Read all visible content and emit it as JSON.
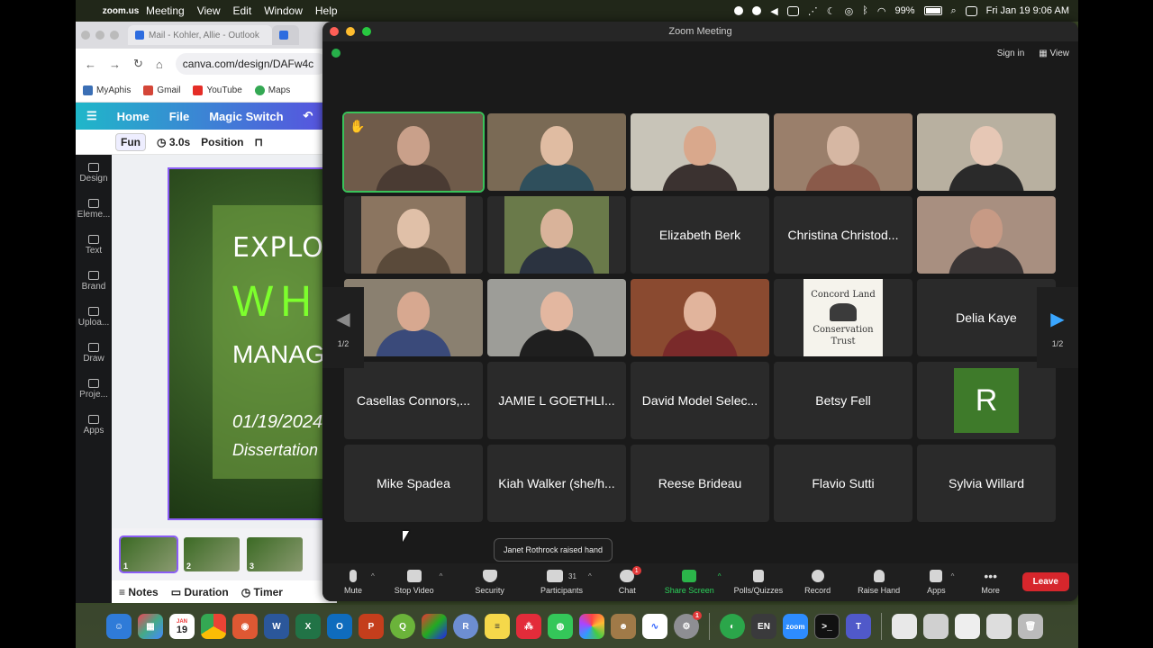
{
  "menubar": {
    "app": "zoom.us",
    "items": [
      "Meeting",
      "View",
      "Edit",
      "Window",
      "Help"
    ],
    "battery": "99%",
    "datetime": "Fri Jan 19  9:06 AM"
  },
  "browser": {
    "tab_title": "Mail - Kohler, Allie - Outlook",
    "url": "canva.com/design/DAFw4c",
    "bookmarks": [
      "MyAphis",
      "Gmail",
      "YouTube",
      "Maps"
    ]
  },
  "canva": {
    "menu": [
      "Home",
      "File",
      "Magic Switch"
    ],
    "toolbar": {
      "fun": "Fun",
      "duration": "3.0s",
      "position": "Position"
    },
    "sidebar": [
      "Design",
      "Eleme...",
      "Text",
      "Brand",
      "Uploa...",
      "Draw",
      "Proje...",
      "Apps"
    ],
    "slide": {
      "l1": "EXPLORING",
      "l2": "WHIT",
      "l3": "MANAGEMEN",
      "l4": "01/19/2024",
      "l5": "Dissertation P"
    },
    "thumbs": [
      "1",
      "2",
      "3"
    ],
    "bottom": [
      "Notes",
      "Duration",
      "Timer"
    ]
  },
  "zoom": {
    "title": "Zoom Meeting",
    "sign_in": "Sign in",
    "view": "View",
    "page_left": "1/2",
    "page_right": "1/2",
    "tiles": [
      {
        "name": "",
        "video": true,
        "active": true,
        "hand": true,
        "bg": "#6f5b4a",
        "skin": "#c9a08a",
        "shirt": "#4a3b33"
      },
      {
        "name": "",
        "video": true,
        "bg": "#7a6a55",
        "skin": "#e0bca2",
        "shirt": "#2f4f5c"
      },
      {
        "name": "",
        "video": true,
        "bg": "#c8c4b8",
        "skin": "#d9a88c",
        "shirt": "#3b3230"
      },
      {
        "name": "",
        "video": true,
        "bg": "#9a7f6b",
        "skin": "#d6b7a3",
        "shirt": "#8a5a4a"
      },
      {
        "name": "",
        "video": true,
        "bg": "#b8b0a0",
        "skin": "#e6c7b5",
        "shirt": "#2a2a2a"
      },
      {
        "name": "",
        "video": true,
        "narrow": true,
        "bg": "#8b7560",
        "skin": "#e0c0a8",
        "shirt": "#5a4a3a"
      },
      {
        "name": "",
        "video": true,
        "narrow": true,
        "bg": "#6a7a4a",
        "skin": "#d9b39a",
        "shirt": "#2b3340"
      },
      {
        "name": "Elizabeth Berk"
      },
      {
        "name": "Christina Christod..."
      },
      {
        "name": "",
        "video": true,
        "bg": "#a88f80",
        "skin": "#c79a85",
        "shirt": "#3a3535"
      },
      {
        "name": "",
        "video": true,
        "bg": "#8a8070",
        "skin": "#d7a890",
        "shirt": "#3a4a7a"
      },
      {
        "name": "",
        "video": true,
        "bg": "#9d9d98",
        "skin": "#e3b7a0",
        "shirt": "#1f1f1f"
      },
      {
        "name": "",
        "video": true,
        "bg": "#8a4a30",
        "skin": "#e1b49c",
        "shirt": "#7a2a2a"
      },
      {
        "name": "",
        "logo": true
      },
      {
        "name": "Delia Kaye"
      },
      {
        "name": "Casellas Connors,..."
      },
      {
        "name": "JAMIE L GOETHLI..."
      },
      {
        "name": "David Model Selec..."
      },
      {
        "name": "Betsy Fell"
      },
      {
        "name": "",
        "avatar": "R"
      },
      {
        "name": "Mike Spadea"
      },
      {
        "name": "Kiah Walker (she/h..."
      },
      {
        "name": "Reese Brideau"
      },
      {
        "name": "Flavio Sutti"
      },
      {
        "name": "Sylvia Willard"
      }
    ],
    "logo": {
      "top": "Concord Land",
      "bottom": "Conservation Trust"
    },
    "toast": "Janet Rothrock raised hand",
    "toolbar": {
      "mute": "Mute",
      "stop_video": "Stop Video",
      "security": "Security",
      "participants": "Participants",
      "participants_count": "31",
      "chat": "Chat",
      "chat_badge": "1",
      "share": "Share Screen",
      "polls": "Polls/Quizzes",
      "record": "Record",
      "raise_hand": "Raise Hand",
      "apps": "Apps",
      "more": "More",
      "leave": "Leave"
    }
  },
  "dock": {
    "calendar_month": "JAN",
    "calendar_day": "19",
    "lang": "EN",
    "zoom": "zoom",
    "notification_badge": "1"
  },
  "colors": {
    "accent_green": "#2bb54a",
    "leave_red": "#d6262c",
    "canva_purple": "#8a5cf5"
  }
}
